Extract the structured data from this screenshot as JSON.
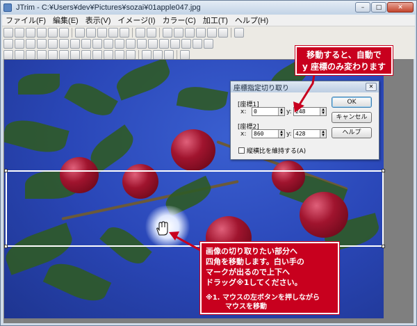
{
  "window": {
    "title": "JTrim - C:¥Users¥dev¥Pictures¥sozai¥01apple047.jpg",
    "minimize": "–",
    "maximize": "□",
    "close": "✕"
  },
  "menu": [
    "ファイル(F)",
    "編集(E)",
    "表示(V)",
    "イメージ(I)",
    "カラー(C)",
    "加工(T)",
    "ヘルプ(H)"
  ],
  "dialog": {
    "title": "座標指定切り取り",
    "close": "✕",
    "group1_label": "[座標1]",
    "group2_label": "[座標2]",
    "x_label": "x:",
    "y_label": "y:",
    "coord1_x": "0",
    "coord1_y": "248",
    "coord2_x": "860",
    "coord2_y": "428",
    "ok_label": "OK",
    "cancel_label": "キャンセル",
    "help_label": "ヘルプ",
    "aspect_label": "縦横比を維持する(A)",
    "aspect_checked": false
  },
  "callouts": {
    "top_line1": "移動すると、自動で",
    "top_line2": "y 座標のみ変わります",
    "bottom_line1": "画像の切り取りたい部分へ",
    "bottom_line2": "四角を移動します。白い手の",
    "bottom_line3": "マークが出るので上下へ",
    "bottom_line4": "ドラッグ※1してください。",
    "bottom_note1": "※1. マウスの左ボタンを押しながら",
    "bottom_note2": "マウスを移動"
  },
  "colors": {
    "callout": "#c8001e",
    "sky": "#2a47b8",
    "selection": "#ffffff"
  },
  "icons": [
    "app-icon",
    "hand-cursor-icon",
    "arrow-icon"
  ]
}
